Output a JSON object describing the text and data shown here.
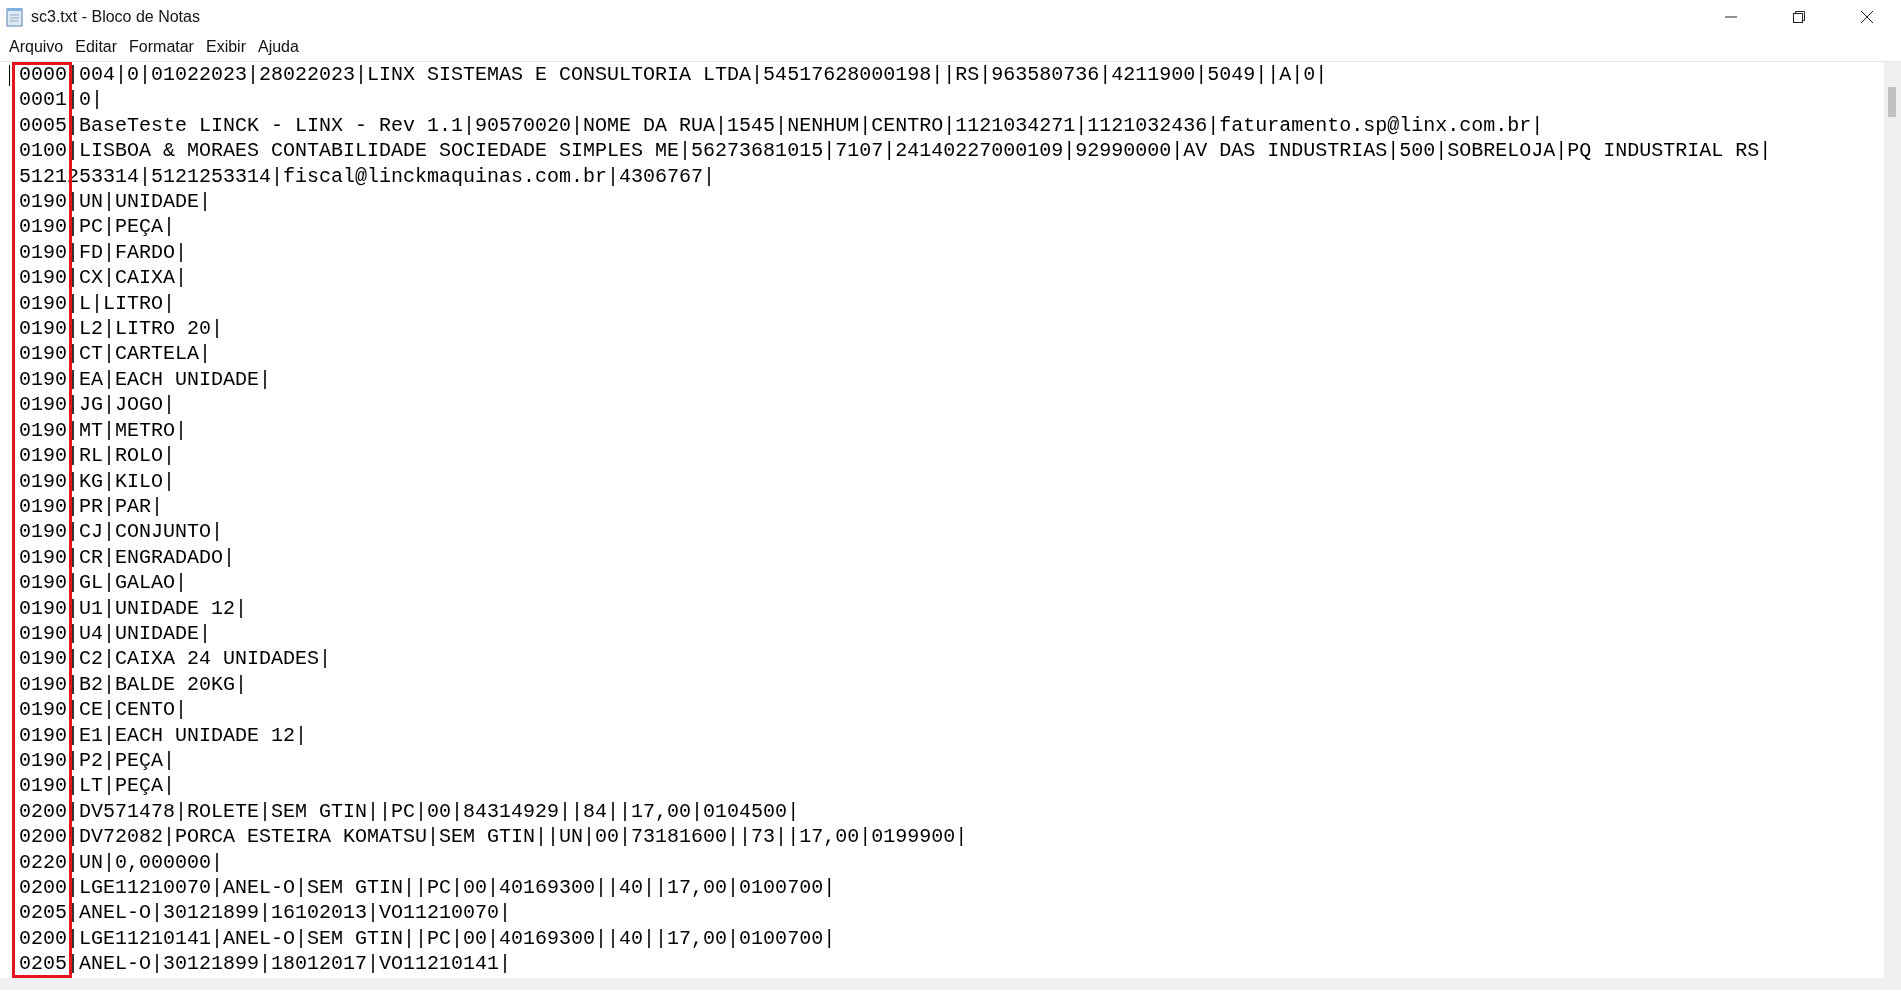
{
  "window": {
    "title": "sc3.txt - Bloco de Notas"
  },
  "menu": [
    "Arquivo",
    "Editar",
    "Formatar",
    "Exibir",
    "Ajuda"
  ],
  "editor": {
    "annotation": {
      "kind": "rectangle",
      "color": "#e3151a"
    },
    "lines": [
      "0000|004|0|01022023|28022023|LINX SISTEMAS E CONSULTORIA LTDA|54517628000198||RS|963580736|4211900|5049||A|0|",
      "0001|0|",
      "0005|BaseTeste LINCK - LINX - Rev 1.1|90570020|NOME DA RUA|1545|NENHUM|CENTRO|1121034271|1121032436|faturamento.sp@linx.com.br|",
      "0100|LISBOA & MORAES CONTABILIDADE SOCIEDADE SIMPLES ME|56273681015|7107|24140227000109|92990000|AV DAS INDUSTRIAS|500|SOBRELOJA|PQ INDUSTRIAL RS|",
      "5121253314|5121253314|fiscal@linckmaquinas.com.br|4306767|",
      "0190|UN|UNIDADE|",
      "0190|PC|PEÇA|",
      "0190|FD|FARDO|",
      "0190|CX|CAIXA|",
      "0190|L|LITRO|",
      "0190|L2|LITRO 20|",
      "0190|CT|CARTELA|",
      "0190|EA|EACH UNIDADE|",
      "0190|JG|JOGO|",
      "0190|MT|METRO|",
      "0190|RL|ROLO|",
      "0190|KG|KILO|",
      "0190|PR|PAR|",
      "0190|CJ|CONJUNTO|",
      "0190|CR|ENGRADADO|",
      "0190|GL|GALAO|",
      "0190|U1|UNIDADE 12|",
      "0190|U4|UNIDADE|",
      "0190|C2|CAIXA 24 UNIDADES|",
      "0190|B2|BALDE 20KG|",
      "0190|CE|CENTO|",
      "0190|E1|EACH UNIDADE 12|",
      "0190|P2|PEÇA|",
      "0190|LT|PEÇA|",
      "0200|DV571478|ROLETE|SEM GTIN||PC|00|84314929||84||17,00|0104500|",
      "0200|DV72082|PORCA ESTEIRA KOMATSU|SEM GTIN||UN|00|73181600||73||17,00|0199900|",
      "0220|UN|0,000000|",
      "0200|LGE11210070|ANEL-O|SEM GTIN||PC|00|40169300||40||17,00|0100700|",
      "0205|ANEL-O|30121899|16102013|VO11210070|",
      "0200|LGE11210141|ANEL-O|SEM GTIN||PC|00|40169300||40||17,00|0100700|",
      "0205|ANEL-O|30121899|18012017|VO11210141|"
    ]
  }
}
